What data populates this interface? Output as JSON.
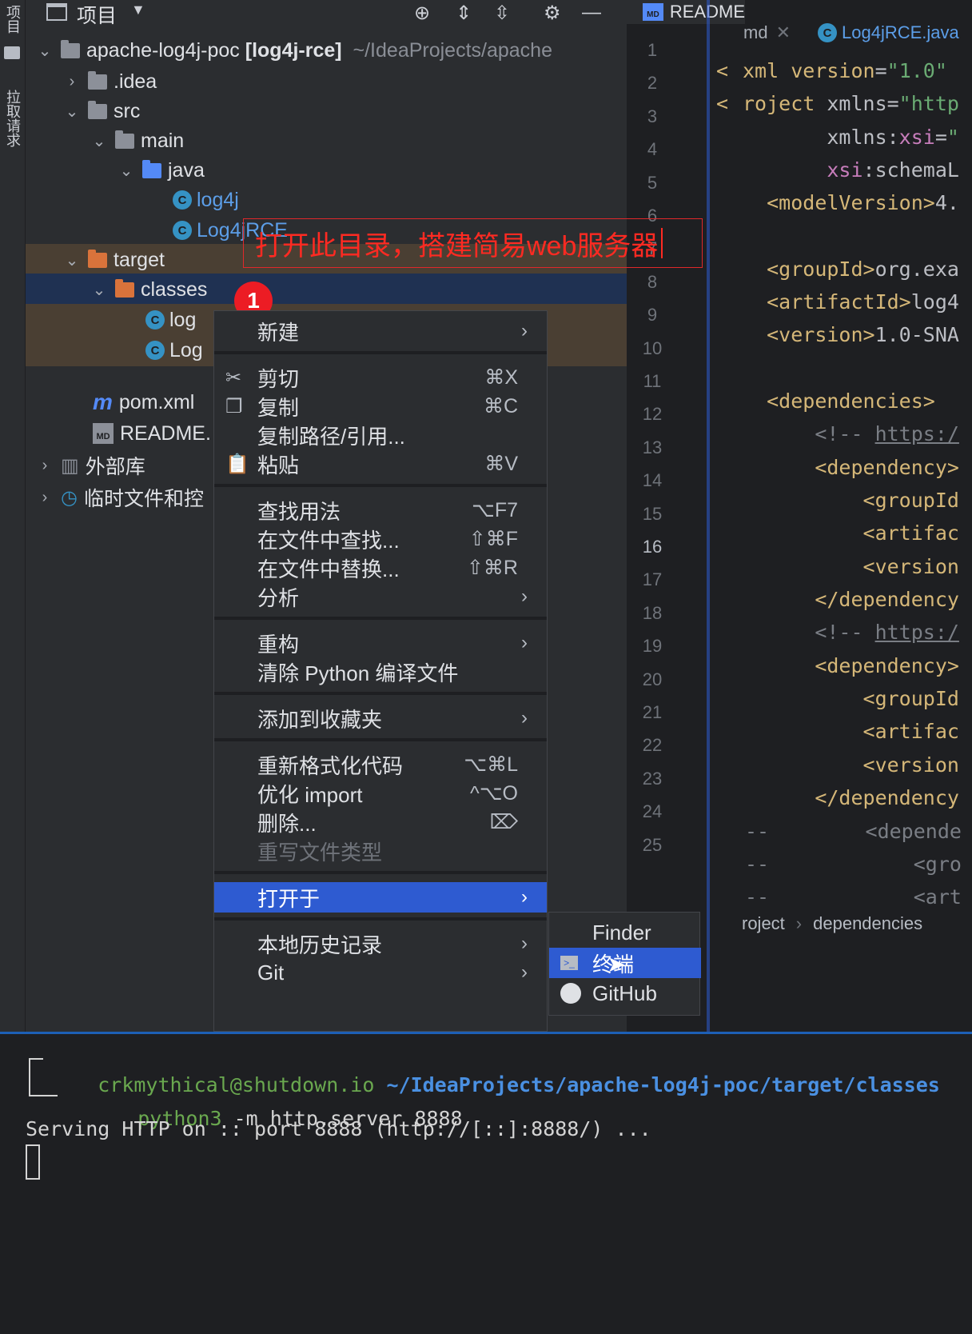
{
  "left_strip": {
    "project_tab": "项目",
    "pull_requests_tab": "拉取请求"
  },
  "project_panel": {
    "title": "项目",
    "tree": {
      "root_name": "apache-log4j-poc",
      "root_module": "[log4j-rce]",
      "root_path": "~/IdeaProjects/apache",
      "idea": ".idea",
      "src": "src",
      "main": "main",
      "java": "java",
      "log4j": "log4j",
      "log4jrce": "Log4jRCE",
      "target": "target",
      "classes": "classes",
      "classes_log4j": "log",
      "classes_log4jrce": "Log",
      "pom": "pom.xml",
      "readme": "README.",
      "external_libs": "外部库",
      "scratches": "临时文件和控"
    }
  },
  "editor": {
    "tabs": [
      {
        "label": "README"
      },
      {
        "label": "md"
      },
      {
        "label": "Log4jRCE.java"
      }
    ],
    "line_numbers": [
      "1",
      "2",
      "3",
      "4",
      "5",
      "6",
      "7",
      "8",
      "9",
      "10",
      "11",
      "12",
      "13",
      "14",
      "15",
      "16",
      "17",
      "18",
      "19",
      "20",
      "21",
      "22",
      "23",
      "24",
      "25"
    ],
    "current_line": "16",
    "breadcrumb": {
      "item1": "roject",
      "item2": "dependencies"
    }
  },
  "annotation": {
    "text": "打开此目录，搭建简易web服务器",
    "step": "1"
  },
  "context_menu": {
    "new": "新建",
    "cut": "剪切",
    "cut_sc": "⌘X",
    "copy": "复制",
    "copy_sc": "⌘C",
    "copy_path": "复制路径/引用...",
    "paste": "粘贴",
    "paste_sc": "⌘V",
    "find_usages": "查找用法",
    "find_usages_sc": "⌥F7",
    "find_in_files": "在文件中查找...",
    "find_in_files_sc": "⇧⌘F",
    "replace_in_files": "在文件中替换...",
    "replace_in_files_sc": "⇧⌘R",
    "analyze": "分析",
    "refactor": "重构",
    "clean_python": "清除 Python 编译文件",
    "add_favorites": "添加到收藏夹",
    "reformat": "重新格式化代码",
    "reformat_sc": "⌥⌘L",
    "optimize_imports": "优化 import",
    "optimize_imports_sc": "^⌥O",
    "delete": "删除...",
    "override_type": "重写文件类型",
    "open_in": "打开于",
    "local_history": "本地历史记录",
    "git": "Git"
  },
  "submenu": {
    "finder": "Finder",
    "terminal": "终端",
    "github": "GitHub"
  },
  "terminal": {
    "user_host": "crkmythical@shutdown.io",
    "cwd": "~/IdeaProjects/apache-log4j-poc/target/classes",
    "cmd_name": "python3",
    "cmd_args": " -m http.server 8888",
    "output": "Serving HTTP on :: port 8888 (http://[::]:8888/) ..."
  },
  "colors": {
    "accent_blue": "#2e5bd1",
    "annotation_red": "#ff2a22",
    "selection": "#1f3152"
  }
}
